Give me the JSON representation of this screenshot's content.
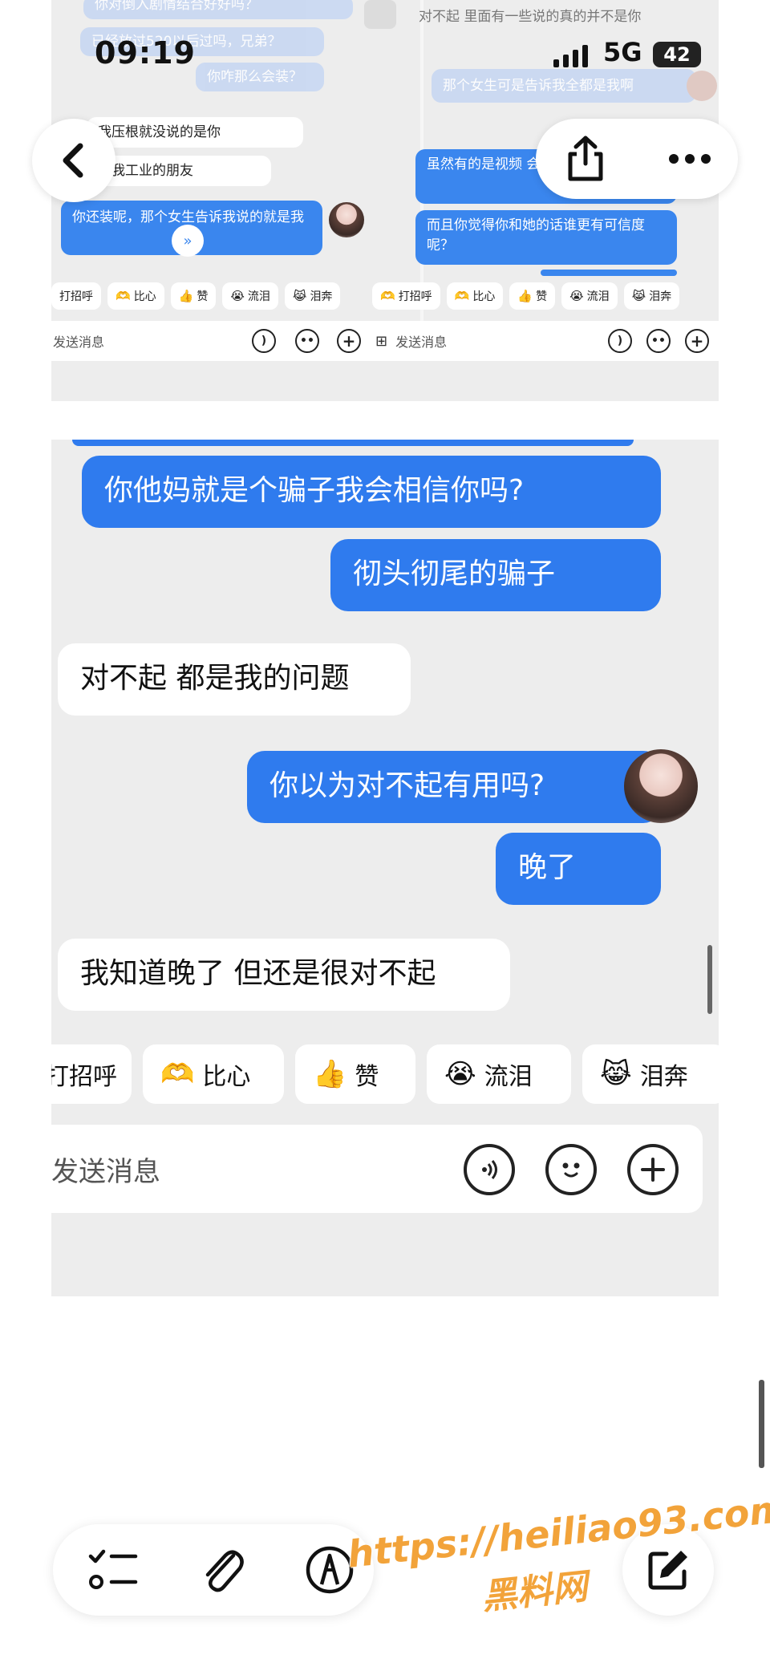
{
  "status_bar": {
    "time": "09:19",
    "network": "5G",
    "battery": "42"
  },
  "shot1": {
    "left_messages": [
      {
        "text": "你对倒入剧情结合好好吗？",
        "style": "pale"
      },
      {
        "text": "已经放过520以后过吗，兄弟？",
        "style": "pale"
      },
      {
        "text": "你咋那么会装？",
        "style": "pale"
      },
      {
        "text": "我压根就没说的是你",
        "style": "white"
      },
      {
        "text": "是我工业的朋友",
        "style": "white"
      },
      {
        "text": "你还装呢，那个女生告诉我说的就是我",
        "style": "blue"
      }
    ],
    "right_messages": [
      {
        "text": "对不起 里面有一些说的真的并不是你",
        "style": "gray"
      },
      {
        "text": "那个女生可是告诉我全都是我啊",
        "style": "pale"
      },
      {
        "text": "虽然有的是视频 会记错呢？",
        "style": "blue"
      },
      {
        "text": "而且你觉得你和她的话谁更有可信度呢？",
        "style": "blue"
      }
    ],
    "quick_left": [
      {
        "emoji": "",
        "label": "打招呼"
      },
      {
        "emoji": "🫶",
        "label": "比心"
      },
      {
        "emoji": "👍",
        "label": "赞"
      },
      {
        "emoji": "😭",
        "label": "流泪"
      },
      {
        "emoji": "😹",
        "label": "泪奔"
      }
    ],
    "quick_right": [
      {
        "emoji": "🫶",
        "label": "打招呼"
      },
      {
        "emoji": "🫶",
        "label": "比心"
      },
      {
        "emoji": "👍",
        "label": "赞"
      },
      {
        "emoji": "😭",
        "label": "流泪"
      },
      {
        "emoji": "😹",
        "label": "泪奔"
      }
    ],
    "send_placeholder": "发送消息"
  },
  "shot2": {
    "messages": [
      {
        "text": "你他妈就是个骗子我会相信你吗?",
        "side": "right"
      },
      {
        "text": "彻头彻尾的骗子",
        "side": "right"
      },
      {
        "text": "对不起 都是我的问题",
        "side": "left"
      },
      {
        "text": "你以为对不起有用吗?",
        "side": "right"
      },
      {
        "text": "晚了",
        "side": "right"
      },
      {
        "text": "我知道晚了 但还是很对不起",
        "side": "left"
      }
    ],
    "quick_replies": [
      {
        "emoji": "",
        "label": "打招呼"
      },
      {
        "emoji": "🫶",
        "label": "比心"
      },
      {
        "emoji": "👍",
        "label": "赞"
      },
      {
        "emoji": "😭",
        "label": "流泪"
      },
      {
        "emoji": "😹",
        "label": "泪奔"
      }
    ],
    "send_placeholder": "发送消息"
  },
  "watermark": {
    "url": "https://heiliao93.com",
    "name": "黑料网"
  },
  "icons": {
    "back": "chevron-left-icon",
    "share": "share-icon",
    "more": "more-icon",
    "checklist": "checklist-icon",
    "attach": "paperclip-icon",
    "markup": "markup-pen-icon",
    "compose": "compose-icon"
  }
}
